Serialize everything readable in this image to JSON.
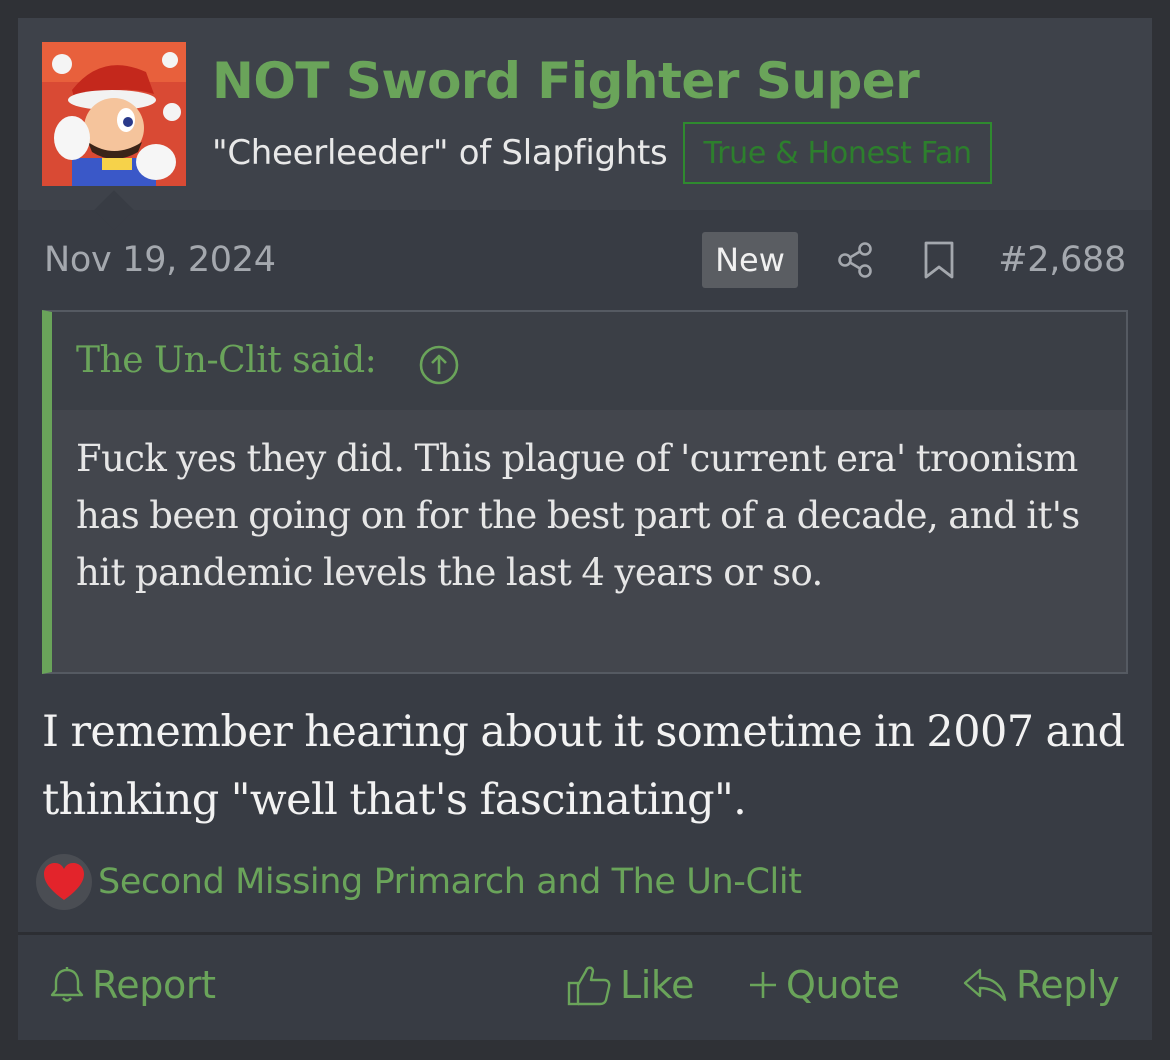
{
  "user": {
    "name": "NOT Sword Fighter Super",
    "title": "\"Cheerleeder\" of Slapfights",
    "banner": "True & Honest Fan"
  },
  "meta": {
    "date": "Nov 19, 2024",
    "badge": "New",
    "post_number": "#2,688"
  },
  "quote": {
    "author": "The Un-Clit said:",
    "text": "Fuck yes they did. This plague of 'current era' troonism has been going on for the best part of a decade, and it's hit pandemic levels the last 4 years or so."
  },
  "body": {
    "text": "I remember hearing about it sometime in 2007 and thinking \"well that's fascinating\"."
  },
  "reactions": {
    "icon": "heart-icon",
    "users": "Second Missing Primarch and The Un-Clit"
  },
  "actions": {
    "report": "Report",
    "like": "Like",
    "quote": "Quote",
    "reply": "Reply"
  },
  "colors": {
    "accent": "#6aa45a",
    "background": "#383c44",
    "banner_border": "#2f8a2f"
  }
}
